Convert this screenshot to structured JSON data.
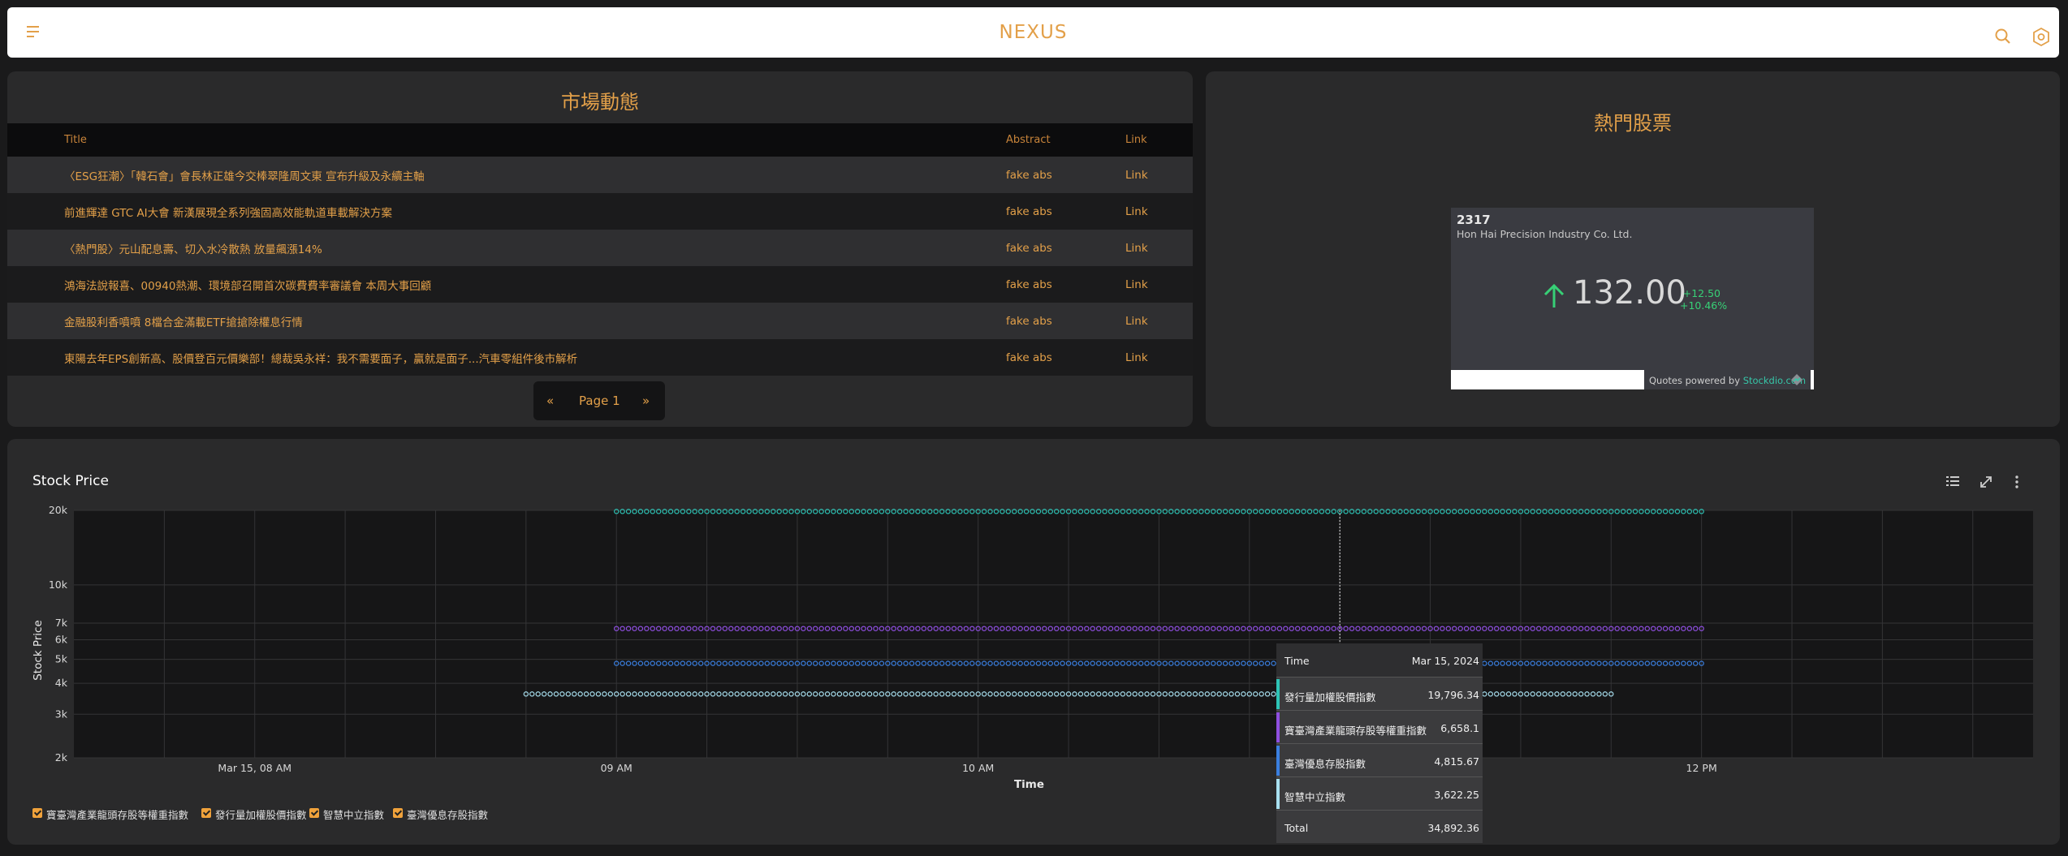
{
  "app": {
    "title": "NEXUS"
  },
  "news": {
    "title": "市場動態",
    "columns": [
      "Title",
      "Abstract",
      "Link"
    ],
    "rows": [
      {
        "title": "〈ESG狂潮〉「韓石會」會長林正雄今交棒翠隆周文東 宣布升級及永續主軸",
        "abstract": "fake abs",
        "link": "Link"
      },
      {
        "title": "前進輝達 GTC AI大會 新漢展現全系列強固高效能軌道車載解決方案",
        "abstract": "fake abs",
        "link": "Link"
      },
      {
        "title": "〈熱門股〉元山配息壽、切入水冷散熱 放量飆漲14%",
        "abstract": "fake abs",
        "link": "Link"
      },
      {
        "title": "鴻海法說報喜、00940熱潮、環境部召開首次碳費費率審議會 本周大事回顧",
        "abstract": "fake abs",
        "link": "Link"
      },
      {
        "title": "金融股利香噴噴 8檔合金滿載ETF搶搶除權息行情",
        "abstract": "fake abs",
        "link": "Link"
      },
      {
        "title": "東陽去年EPS創新高、股價登百元價樂部！總裁吳永祥：我不需要面子，贏就是面子...汽車零組件後市解析",
        "abstract": "fake abs",
        "link": "Link"
      }
    ],
    "pager": {
      "prev": "«",
      "label": "Page 1",
      "next": "»"
    }
  },
  "hot": {
    "title": "熱門股票",
    "symbol": "2317",
    "name": "Hon Hai Precision Industry Co. Ltd.",
    "price": "132.00",
    "change": "+12.50",
    "change_pct": "+10.46%",
    "quotes_prefix": "Quotes powered by ",
    "quotes_brand": "Stockdio.com",
    "up_color": "#37d076"
  },
  "chart_panel": {
    "title": "Stock Price"
  },
  "chart_data": {
    "type": "scatter",
    "title": "",
    "xlabel": "Time",
    "ylabel": "Stock Price",
    "y_scale": "log",
    "ylim": [
      2000,
      20000
    ],
    "y_ticks": [
      2000,
      3000,
      4000,
      5000,
      6000,
      7000,
      10000,
      20000
    ],
    "y_tick_labels": [
      "2k",
      "3k",
      "4k",
      "5k",
      "6k",
      "7k",
      "10k",
      "20k"
    ],
    "x_ticks": [
      "Mar 15, 08 AM",
      "09 AM",
      "10 AM",
      "11 AM",
      "12 PM"
    ],
    "x_tick_labels_shown": [
      "Mar 15, 08 AM",
      "09 AM",
      "10 AM",
      "",
      "12 PM"
    ],
    "xlim": [
      "07:30",
      "12:55"
    ],
    "grid": true,
    "legend_position": "bottom-left",
    "series": [
      {
        "name": "發行量加權股價指數",
        "color": "#2ec4b6",
        "start": "09:00",
        "end": "12:00",
        "value": 19796.34
      },
      {
        "name": "寶臺灣產業龍頭存股等權重指數",
        "color": "#8f4fe0",
        "start": "09:00",
        "end": "12:00",
        "value": 6658.1
      },
      {
        "name": "臺灣優息存股指數",
        "color": "#3a7fe0",
        "start": "09:00",
        "end": "12:00",
        "value": 4815.67
      },
      {
        "name": "智慧中立指數",
        "color": "#a8e0f0",
        "start": "08:45",
        "end": "11:45",
        "value": 3622.25
      }
    ],
    "legend_order": [
      "寶臺灣產業龍頭存股等權重指數",
      "發行量加權股價指數",
      "智慧中立指數",
      "臺灣優息存股指數"
    ],
    "cursor_time": "11:00",
    "tooltip": {
      "time_label": "Time",
      "time_value": "Mar 15, 2024",
      "rows": [
        {
          "name": "發行量加權股價指數",
          "value": "19,796.34",
          "color": "#2ec4b6"
        },
        {
          "name": "寶臺灣產業龍頭存股等權重指數",
          "value": "6,658.1",
          "color": "#8f4fe0"
        },
        {
          "name": "臺灣優息存股指數",
          "value": "4,815.67",
          "color": "#3a7fe0"
        },
        {
          "name": "智慧中立指數",
          "value": "3,622.25",
          "color": "#a8e0f0"
        }
      ],
      "total_label": "Total",
      "total_value": "34,892.36"
    }
  }
}
